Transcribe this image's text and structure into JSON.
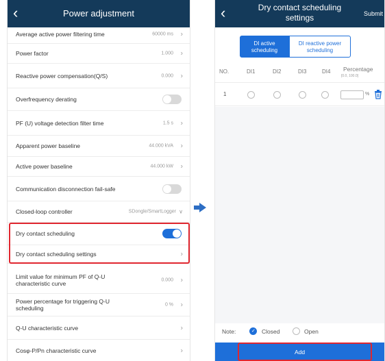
{
  "left": {
    "title": "Power adjustment",
    "rows": [
      {
        "label": "Average active power filtering time",
        "value": "60000 ms"
      },
      {
        "label": "Power factor",
        "value": "1.000"
      },
      {
        "label": "Reactive power compensation(Q/S)",
        "value": "0.000"
      },
      {
        "label": "Overfrequency derating",
        "toggle": "off"
      },
      {
        "label": "PF (U) voltage detection filter time",
        "value": "1.5 s"
      },
      {
        "label": "Apparent power baseline",
        "value": "44.000 kVA"
      },
      {
        "label": "Active power baseline",
        "value": "44.000 kW"
      },
      {
        "label": "Communication disconnection fail-safe",
        "toggle": "off"
      },
      {
        "label": "Closed-loop controller",
        "value": "SDongle/SmartLogger"
      },
      {
        "label": "Dry contact scheduling",
        "toggle": "on"
      },
      {
        "label": "Dry contact scheduling settings",
        "value": ""
      },
      {
        "label": "Limit value for minimum PF of Q-U characteristic curve",
        "value": "0.000"
      },
      {
        "label": "Power percentage for triggering Q-U scheduling",
        "value": "0 %"
      },
      {
        "label": "Q-U characteristic curve",
        "value": ""
      },
      {
        "label": "Cosφ-P/Pn characteristic curve",
        "value": ""
      }
    ]
  },
  "right": {
    "title_line1": "Dry contact scheduling",
    "title_line2": "settings",
    "submit": "Submit",
    "tabs": [
      {
        "line1": "DI active",
        "line2": "scheduling",
        "active": true
      },
      {
        "line1": "DI reactive power",
        "line2": "scheduling",
        "active": false
      }
    ],
    "columns": [
      "NO.",
      "DI1",
      "DI2",
      "DI3",
      "DI4",
      "Percentage"
    ],
    "percentage_range": "[0.0, 100.0]",
    "rows": [
      {
        "no": "1",
        "percent_value": "",
        "unit": "%"
      }
    ],
    "note_label": "Note:",
    "legend_closed": "Closed",
    "legend_open": "Open",
    "add_label": "Add"
  },
  "colors": {
    "header": "#143a5a",
    "accent": "#1e6fd9",
    "highlight": "#e0262f"
  },
  "icons": {
    "back": "chevron-left-icon",
    "next": "chevron-right-icon",
    "dropdown": "chevron-down-icon",
    "delete": "trash-icon",
    "flow": "arrow-right-icon"
  }
}
